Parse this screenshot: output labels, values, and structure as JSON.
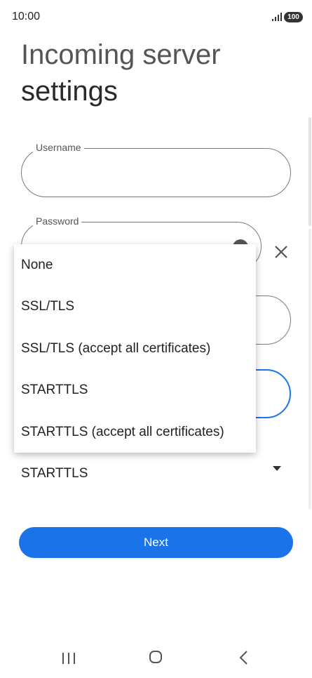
{
  "status_bar": {
    "time": "10:00",
    "battery": "100"
  },
  "page": {
    "title_line1": "Incoming server",
    "title_line2": "settings"
  },
  "form": {
    "username_label": "Username",
    "password_label": "Password",
    "security_selected": "STARTTLS"
  },
  "security_menu": {
    "options": [
      "None",
      "SSL/TLS",
      "SSL/TLS (accept all certificates)",
      "STARTTLS",
      "STARTTLS (accept all certificates)"
    ]
  },
  "actions": {
    "next_label": "Next"
  },
  "icons": {
    "signal": "signal-icon",
    "eye": "eye-icon",
    "clear": "close-icon",
    "dropdown": "dropdown-arrow-icon",
    "recents": "recents-icon",
    "home": "home-icon",
    "back": "back-icon"
  },
  "colors": {
    "accent": "#1a73e8",
    "outline": "#7a7a7a"
  }
}
